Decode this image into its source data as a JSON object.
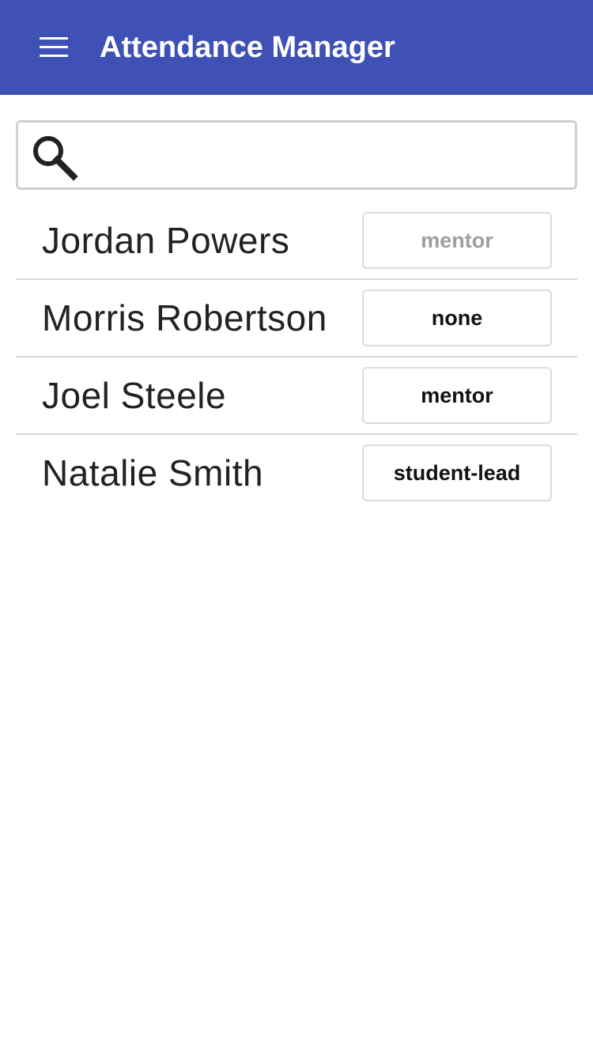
{
  "app_bar": {
    "title": "Attendance Manager",
    "background_color": "#3f51b5",
    "menu_icon": "hamburger-menu-icon"
  },
  "search": {
    "icon": "search-icon",
    "value": "",
    "placeholder": ""
  },
  "members": [
    {
      "name": "Jordan Powers",
      "role": "mentor",
      "role_disabled": true
    },
    {
      "name": "Morris Robertson",
      "role": "none",
      "role_disabled": false
    },
    {
      "name": "Joel Steele",
      "role": "mentor",
      "role_disabled": false
    },
    {
      "name": "Natalie Smith",
      "role": "student-lead",
      "role_disabled": false
    }
  ]
}
